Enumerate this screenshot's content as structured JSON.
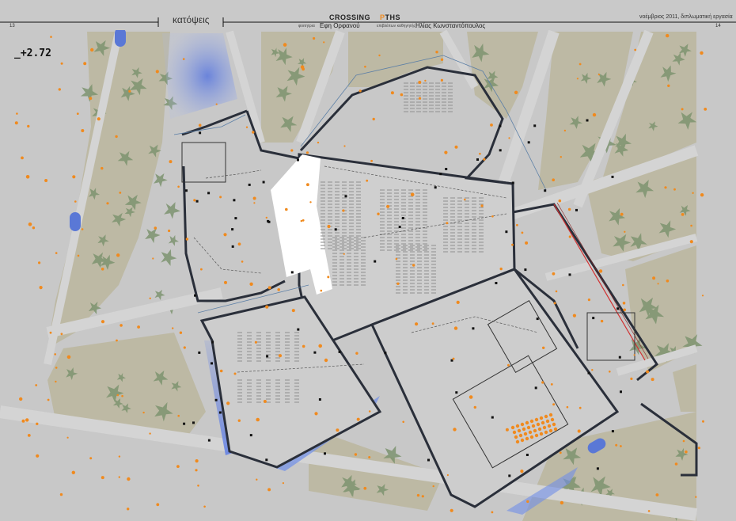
{
  "header": {
    "title": "κατόψεις",
    "page_left": "13",
    "page_right": "14",
    "logo_word1": "CROSSING",
    "logo_word2_accent": "P",
    "logo_word2_rest": "THS",
    "credit1_label": "φοιτητρια",
    "credit1_value": "Εφη Ορφανού",
    "credit2_label": "επιβλέπων καθηγητής",
    "credit2_value": "Ηλίας Κωνσταντόπουλος",
    "date": "νοέμβριος 2011, διπλωματική εργασία"
  },
  "plan": {
    "level_label": "_+2.72"
  },
  "colors": {
    "background": "#c8c8c8",
    "park": "#bdb9a4",
    "tree": "#7e9470",
    "road": "#d4d4d4",
    "wall": "#2a2f3a",
    "accent": "#f08a1e",
    "water": "#5a78d6",
    "blue_fade": "#6f8ee8",
    "red_line": "#d13030"
  }
}
